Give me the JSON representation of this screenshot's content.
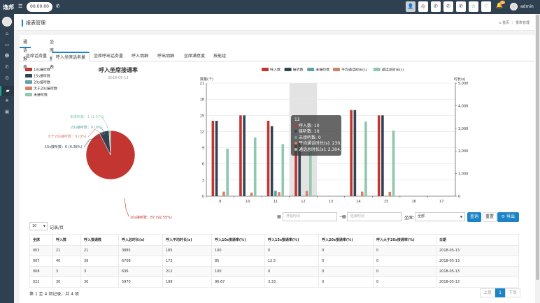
{
  "topbar": {
    "logo": "逸邦",
    "timer": "00:00:00",
    "user": "admin",
    "badge": "1"
  },
  "breadcrumb": {
    "title": "报表管理",
    "home": "首页",
    "separator": "/",
    "current": "报表管理"
  },
  "tabs_main": [
    "通话报表",
    "坐席报表"
  ],
  "tabs_sub": [
    "坐席话务量",
    "呼入坐席话务量",
    "坐席呼出话务量",
    "呼入明细",
    "呼出明细",
    "坐席满意度",
    "技能组"
  ],
  "pie": {
    "legend": [
      "10s接听数",
      "15s接听数",
      "20s接听数",
      "大于20s接听数",
      "未接听数"
    ],
    "colors": [
      "#c23531",
      "#2f4554",
      "#61a0a8",
      "#d48265",
      "#91c7ae"
    ],
    "title": "呼入坐席接通率",
    "subtitle": "2018-05-13",
    "labels": {
      "unanswered": "未接听数：1 (1.07%)",
      "s20": "20s接听数：0 (0%)",
      "gt20": "大于20s接听数：0 (0%)",
      "s15": "15s接听数：6 (6.38%)",
      "s10": "10s接听数：87 (92.55%)"
    }
  },
  "chart_data": [
    {
      "type": "pie",
      "title": "呼入坐席接通率",
      "subtitle": "2018-05-13",
      "categories": [
        "10s接听数",
        "15s接听数",
        "20s接听数",
        "大于20s接听数",
        "未接听数"
      ],
      "values": [
        87,
        6,
        0,
        0,
        1
      ]
    },
    {
      "type": "bar",
      "legend_position": "top-right",
      "ylabel_left": "数量(个)",
      "ylabel_right": "时长(s)",
      "ylim_left": [
        0,
        21
      ],
      "ylim_right": [
        0,
        5000
      ],
      "yticks_left": [
        "0",
        "3",
        "6",
        "9",
        "12",
        "15",
        "18",
        "21"
      ],
      "yticks_right": [
        "0",
        "1,000",
        "2,000",
        "3,000",
        "4,000",
        "5,000"
      ],
      "categories": [
        "9",
        "10",
        "11",
        "12",
        "13",
        "14",
        "15",
        "16",
        "17"
      ],
      "highlight_category": "12",
      "series": [
        {
          "name": "呼入数",
          "color": "#c23531",
          "axis": "left",
          "values": [
            14,
            15,
            14,
            10,
            0,
            16,
            15,
            0,
            0
          ]
        },
        {
          "name": "接听数",
          "color": "#2f4554",
          "axis": "left",
          "values": [
            14,
            15,
            13,
            10,
            0,
            16,
            15,
            0,
            0
          ]
        },
        {
          "name": "未接听数",
          "color": "#61a0a8",
          "axis": "left",
          "values": [
            0,
            0,
            1,
            0,
            0,
            0,
            0,
            0,
            0
          ]
        },
        {
          "name": "平均通话时长(s)",
          "color": "#d48265",
          "axis": "right",
          "values": [
            200,
            160,
            180,
            230,
            0,
            200,
            190,
            0,
            0
          ]
        },
        {
          "name": "通话总时长(s)",
          "color": "#91c7ae",
          "axis": "right",
          "values": [
            2100,
            2600,
            2300,
            2304,
            0,
            3300,
            2900,
            0,
            0
          ]
        }
      ]
    }
  ],
  "tooltip": {
    "title": "12",
    "rows": [
      "呼入数: 10",
      "接听数: 10",
      "未接听数: 0",
      "平均通话时长(s): 230.40",
      "通话总时长(s): 2,304.00"
    ]
  },
  "filters": {
    "start_placeholder": "开始时间",
    "dash": "—",
    "end_placeholder": "结束时间",
    "agent_label": "坐席：",
    "agent_value": "全部",
    "query": "查询",
    "reset": "重置",
    "export": "导出"
  },
  "table": {
    "page_size": "10",
    "page_size_label": "记录/页",
    "headers": [
      "坐席",
      "呼入数",
      "呼入接通数",
      "呼入总时长(s)",
      "呼入平均时长(s)",
      "呼入10s接通率(%)",
      "呼入15s接通率(%)",
      "呼入20s接通率(%)",
      "呼入大于20s接通率(%)",
      "日期"
    ],
    "rows": [
      [
        "003",
        "21",
        "21",
        "3885",
        "185",
        "100",
        "0",
        "0",
        "0",
        "2018-05-13"
      ],
      [
        "007",
        "40",
        "39",
        "6708",
        "172",
        "85",
        "12.5",
        "0",
        "0",
        "2018-05-13"
      ],
      [
        "008",
        "3",
        "3",
        "636",
        "212",
        "100",
        "0",
        "0",
        "0",
        "2018-05-13"
      ],
      [
        "022",
        "30",
        "30",
        "5970",
        "199",
        "96.67",
        "3.33",
        "0",
        "0",
        "2018-05-13"
      ]
    ],
    "summary": "第 1 至 4 项记录，共 4 项",
    "prev": "上页",
    "page": "1",
    "next": "下页"
  }
}
